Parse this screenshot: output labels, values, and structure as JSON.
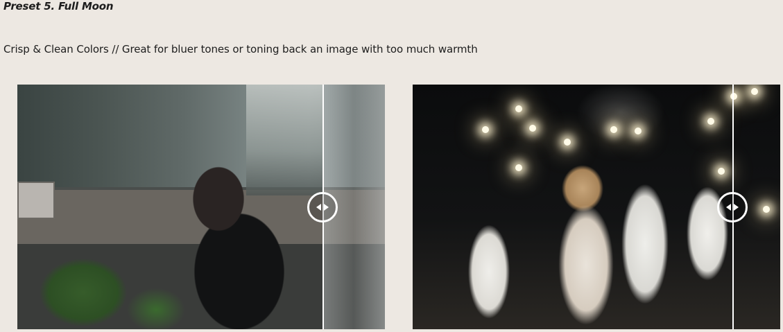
{
  "preset": {
    "title": "Preset 5. Full Moon",
    "description": "Crisp & Clean Colors // Great for bluer tones or toning back an image with too much warmth"
  },
  "comparisons": [
    {
      "name": "portrait-comparison",
      "handle_icon": "left-right-arrows-icon"
    },
    {
      "name": "wedding-comparison",
      "handle_icon": "left-right-arrows-icon"
    }
  ],
  "colors": {
    "background": "#ede8e2",
    "divider": "#ffffff"
  }
}
